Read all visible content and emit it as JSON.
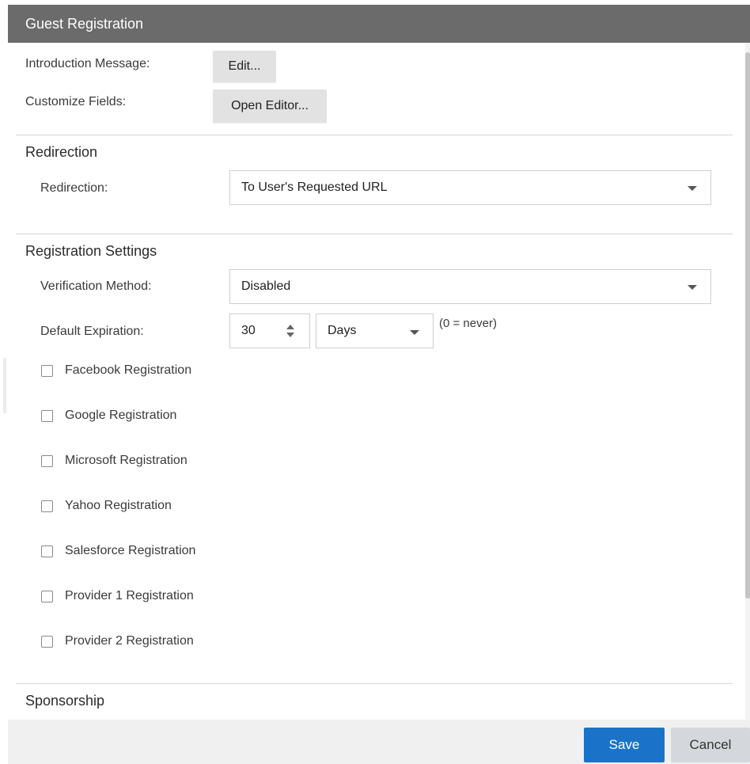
{
  "dialog": {
    "title": "Guest Registration"
  },
  "top": {
    "intro_label": "Introduction Message:",
    "intro_button": "Edit...",
    "customize_label": "Customize Fields:",
    "customize_button": "Open Editor..."
  },
  "redirection": {
    "section_title": "Redirection",
    "label": "Redirection:",
    "selected": "To User's Requested URL"
  },
  "registration": {
    "section_title": "Registration Settings",
    "verification_label": "Verification Method:",
    "verification_selected": "Disabled",
    "expiration_label": "Default Expiration:",
    "expiration_value": "30",
    "expiration_unit": "Days",
    "expiration_hint": "(0 = never)",
    "providers": [
      {
        "label": "Facebook Registration",
        "checked": false
      },
      {
        "label": "Google Registration",
        "checked": false
      },
      {
        "label": "Microsoft Registration",
        "checked": false
      },
      {
        "label": "Yahoo Registration",
        "checked": false
      },
      {
        "label": "Salesforce Registration",
        "checked": false
      },
      {
        "label": "Provider 1 Registration",
        "checked": false
      },
      {
        "label": "Provider 2 Registration",
        "checked": false
      }
    ]
  },
  "sponsorship": {
    "section_title": "Sponsorship"
  },
  "footer": {
    "save_label": "Save",
    "cancel_label": "Cancel"
  },
  "colors": {
    "title_bar": "#6b6b6b",
    "primary_button": "#1a73c8",
    "secondary_button": "#d4d7db"
  }
}
